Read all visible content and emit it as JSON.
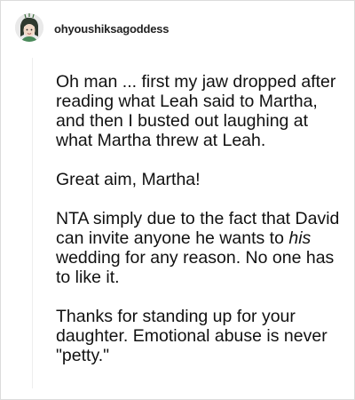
{
  "post": {
    "username": "ohyoushiksagoddess",
    "paragraphs": [
      {
        "text": "Oh man ... first my jaw dropped after reading what Leah said to Martha, and then I busted out laughing at what Martha threw at Leah."
      },
      {
        "text": "Great aim, Martha!"
      },
      {
        "before": "NTA simply due to the fact that David can invite anyone he wants to ",
        "emphasis": "his",
        "after": " wedding for any reason. No one has to like it."
      },
      {
        "text": "Thanks for standing up for your daughter. Emotional abuse is never \"petty.\""
      }
    ]
  },
  "colors": {
    "background": "#ffffff",
    "text": "#111111",
    "username": "#222222"
  }
}
